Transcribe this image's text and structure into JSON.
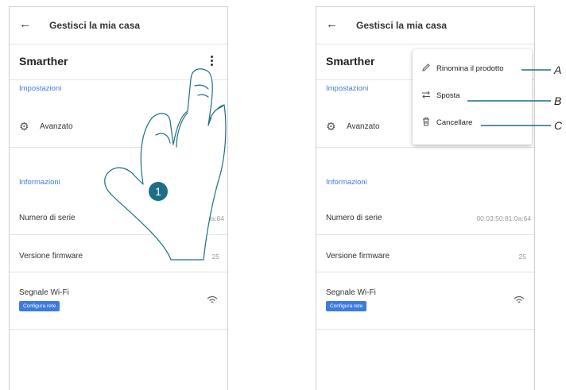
{
  "header": {
    "back_icon": "arrow-left-icon",
    "title": "Gestisci la mia casa"
  },
  "device": {
    "name": "Smarther"
  },
  "sections": {
    "settings": "Impostazioni",
    "info": "Informazioni"
  },
  "advanced": {
    "label": "Avanzato",
    "icon": "gear-icon"
  },
  "serial": {
    "label": "Numero di serie",
    "value": "00:03:50:81:0a:64"
  },
  "firmware": {
    "label": "Versione firmware",
    "value": "25"
  },
  "wifi": {
    "label": "Segnale Wi-Fi",
    "button": "Configura rete",
    "icon": "wifi-icon"
  },
  "step_badge": "1",
  "menu": {
    "items": [
      {
        "label": "Rinomina il prodotto",
        "icon": "pencil-icon"
      },
      {
        "label": "Sposta",
        "icon": "move-arrows-icon"
      },
      {
        "label": "Cancellare",
        "icon": "trash-icon"
      }
    ]
  },
  "callouts": [
    "A",
    "B",
    "C"
  ],
  "colors": {
    "accent": "#3d7be0",
    "badge": "#1b6f86",
    "callout_line": "#1b6f86"
  }
}
